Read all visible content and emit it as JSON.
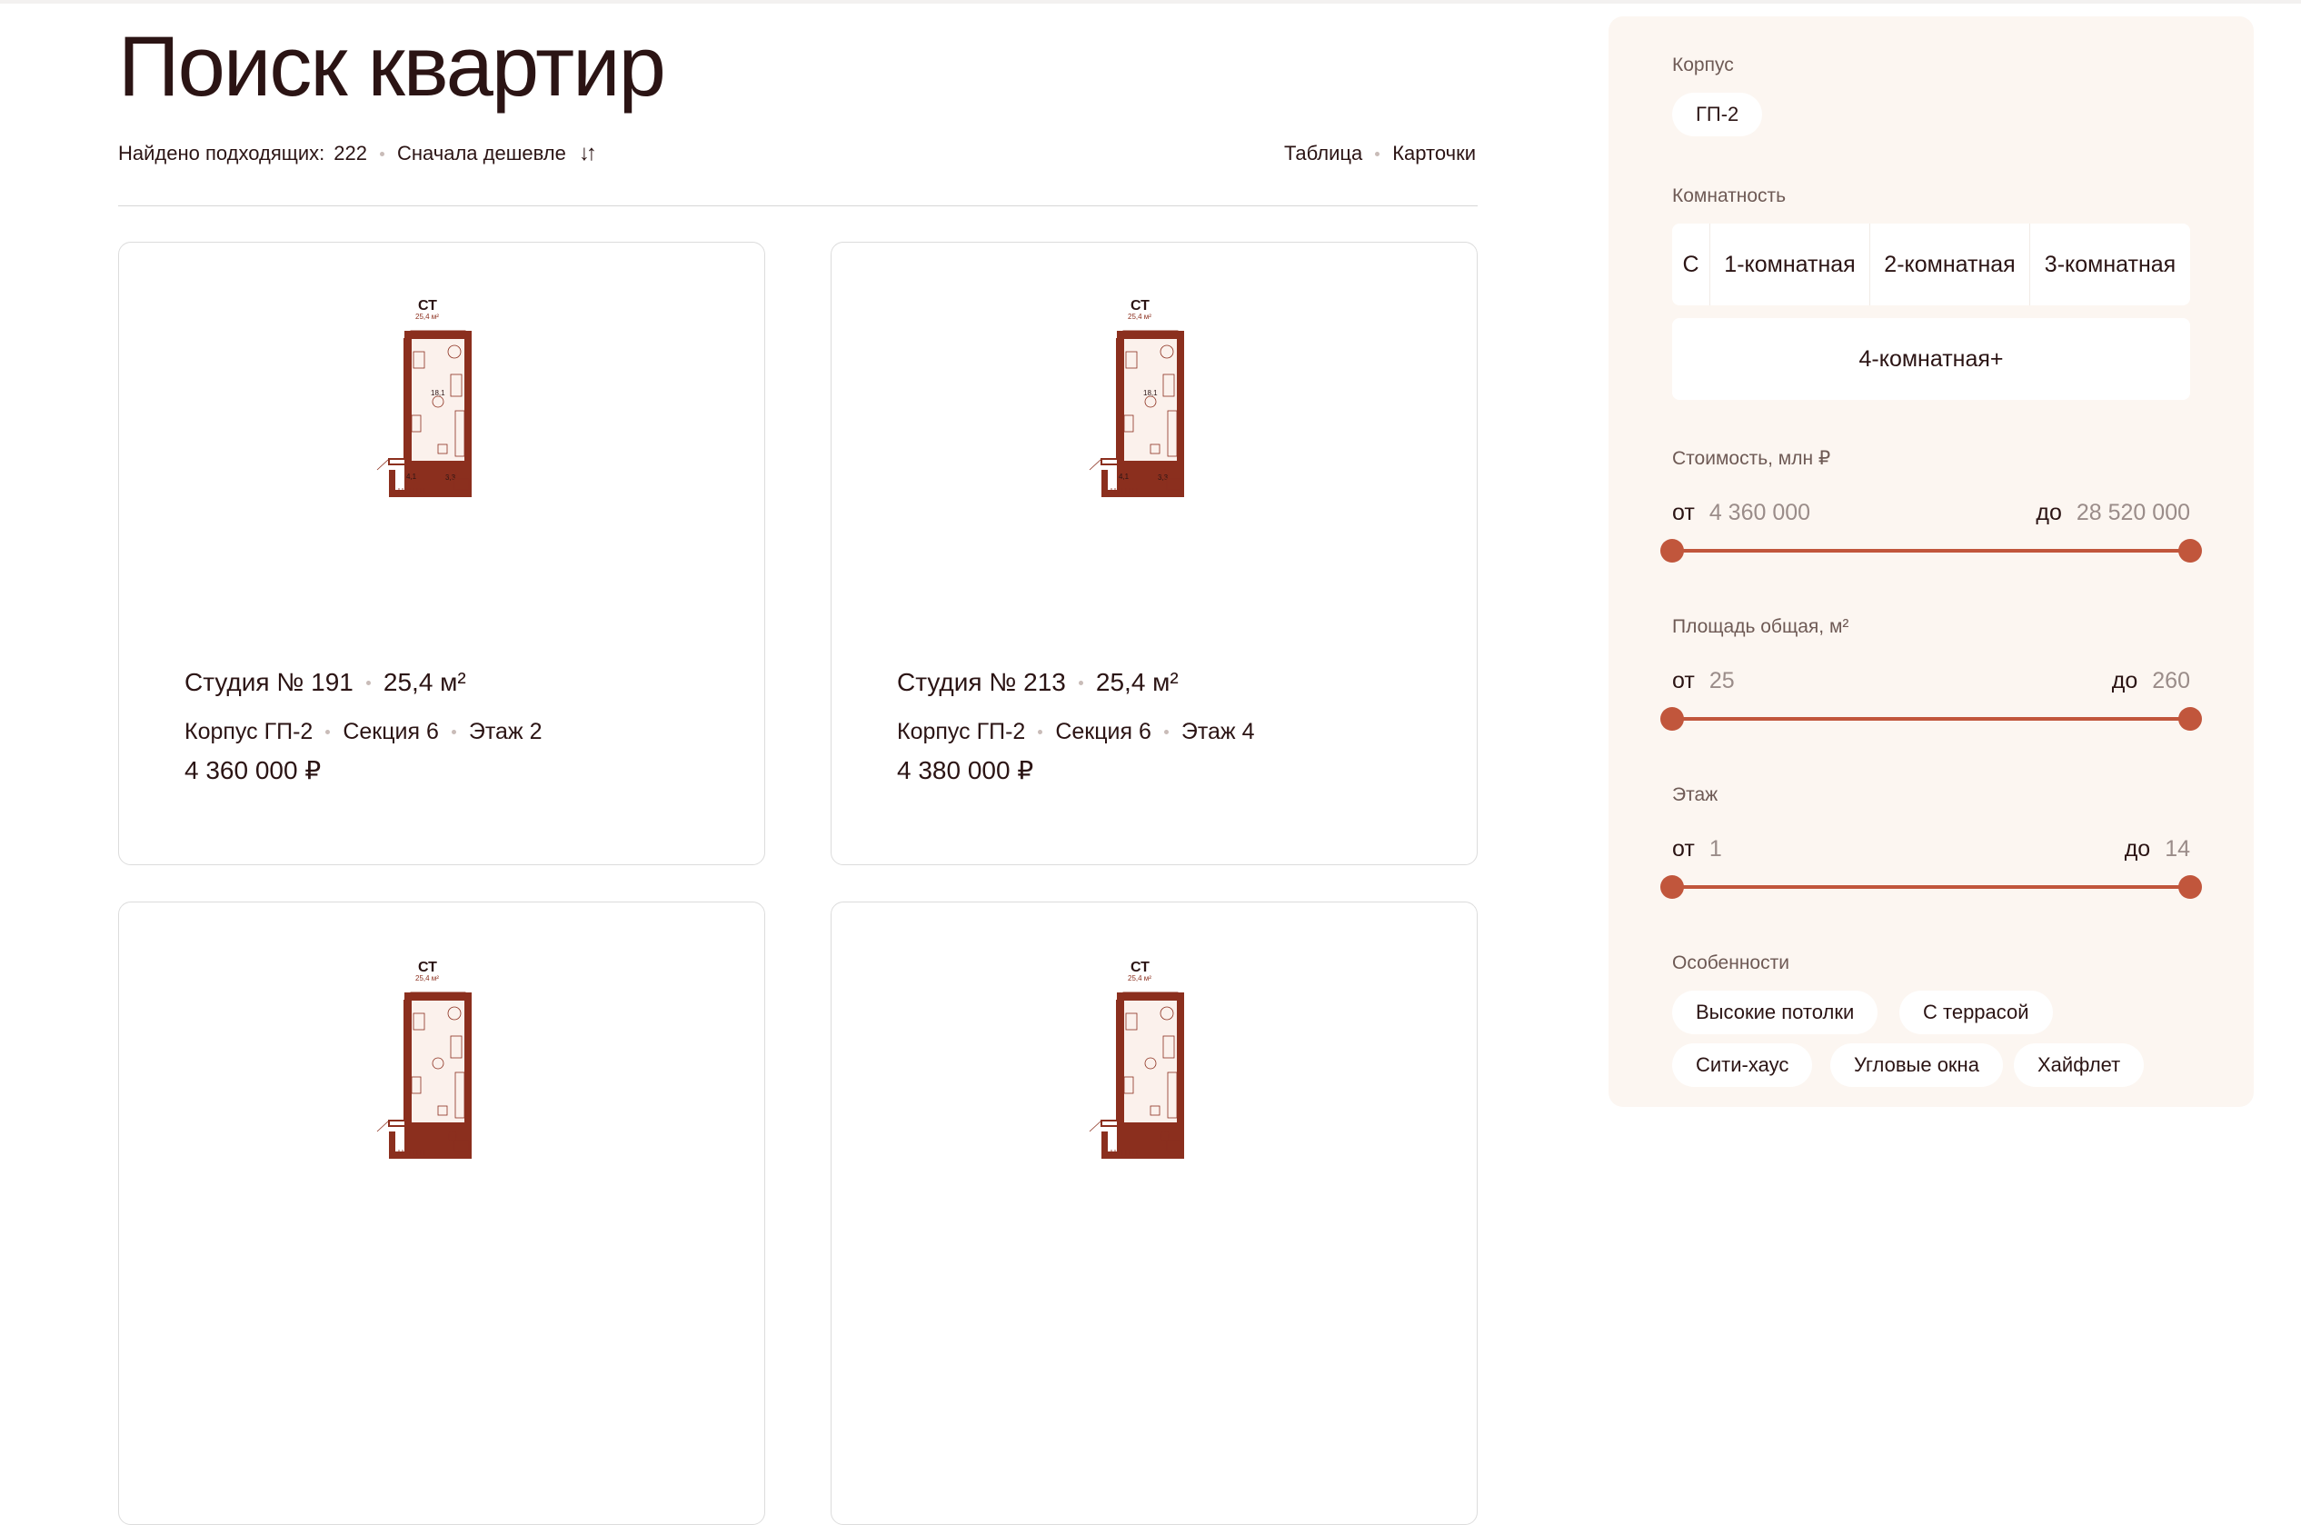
{
  "page": {
    "title": "Поиск квартир",
    "found_label": "Найдено подходящих:",
    "found_count": "222",
    "sort_label": "Сначала дешевле",
    "sort_icon": "sort-arrows-icon",
    "view_table": "Таблица",
    "view_cards": "Карточки"
  },
  "colors": {
    "accent": "#c1563c",
    "text": "#2b1414",
    "panel_bg": "#fcf6f1",
    "plan_wall": "#8b2f1e"
  },
  "cards": [
    {
      "plan_type": "СТ",
      "plan_area": "25,4 м²",
      "plan_room_area": "18,1",
      "plan_hall_area": "4,1",
      "plan_bath_area": "3,3",
      "name": "Студия № 191",
      "area": "25,4 м²",
      "building": "Корпус ГП-2",
      "section": "Секция 6",
      "floor": "Этаж 2",
      "price": "4 360 000 ₽"
    },
    {
      "plan_type": "СТ",
      "plan_area": "25,4 м²",
      "plan_room_area": "18,1",
      "plan_hall_area": "4,1",
      "plan_bath_area": "3,3",
      "name": "Студия № 213",
      "area": "25,4 м²",
      "building": "Корпус ГП-2",
      "section": "Секция 6",
      "floor": "Этаж 4",
      "price": "4 380 000 ₽"
    },
    {
      "plan_type": "СТ",
      "plan_area": "25,4 м²"
    },
    {
      "plan_type": "СТ",
      "plan_area": "25,4 м²"
    }
  ],
  "filters": {
    "building_label": "Корпус",
    "building_value": "ГП-2",
    "rooms_label": "Комнатность",
    "rooms_options": [
      "С",
      "1-комнатная",
      "2-комнатная",
      "3-комнатная",
      "4-комнатная+"
    ],
    "price": {
      "label": "Стоимость, млн ₽",
      "from_label": "от",
      "from_value": "4 360 000",
      "to_label": "до",
      "to_value": "28 520 000",
      "selected_fraction": [
        0,
        1
      ]
    },
    "area": {
      "label": "Площадь общая, м²",
      "from_label": "от",
      "from_value": "25",
      "to_label": "до",
      "to_value": "260",
      "selected_fraction": [
        0,
        1
      ]
    },
    "floor": {
      "label": "Этаж",
      "from_label": "от",
      "from_value": "1",
      "to_label": "до",
      "to_value": "14",
      "selected_fraction": [
        0,
        1
      ]
    },
    "features_label": "Особенности",
    "features": [
      "Высокие потолки",
      "С террасой",
      "Сити-хаус",
      "Угловые окна",
      "Хайфлет"
    ]
  }
}
